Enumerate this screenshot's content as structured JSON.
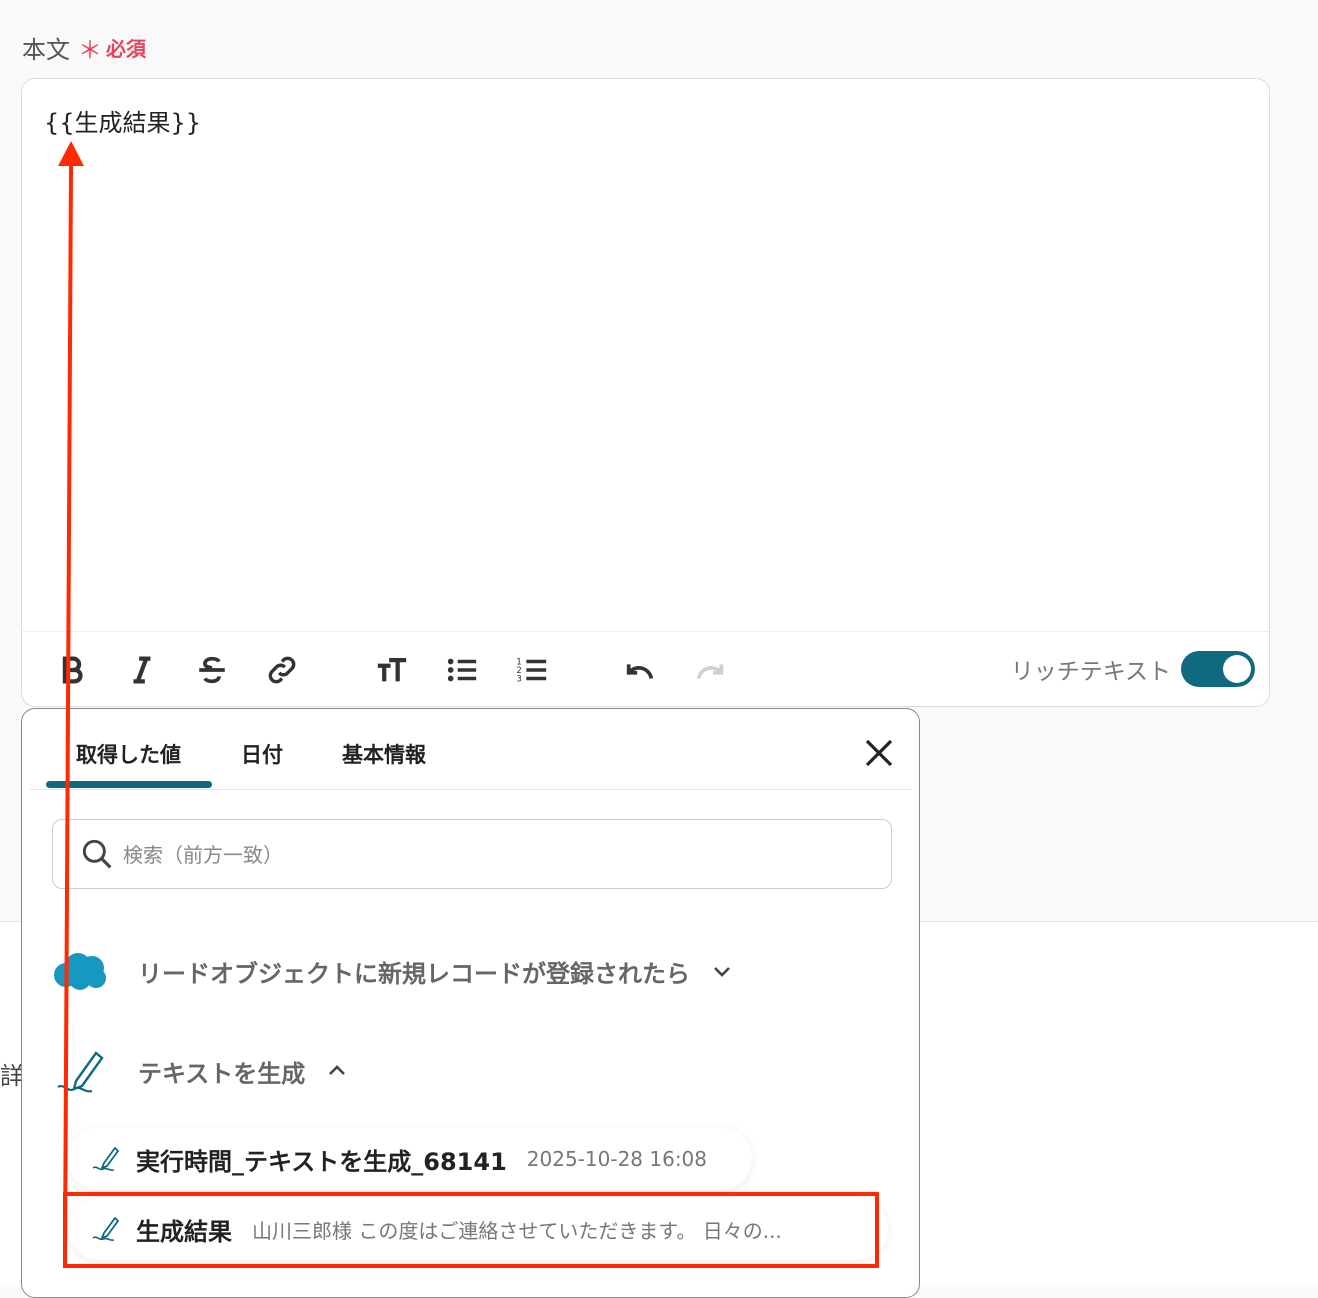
{
  "field": {
    "label": "本文",
    "required_mark": "＊",
    "required_text": "必須"
  },
  "editor": {
    "content": "{{生成結果}}",
    "rich_text_label": "リッチテキスト",
    "rich_text_enabled": true,
    "toolbar_icons": [
      "bold-icon",
      "italic-icon",
      "strikethrough-icon",
      "link-icon",
      "text-size-icon",
      "bullet-list-icon",
      "numbered-list-icon",
      "undo-icon",
      "redo-icon"
    ]
  },
  "panel": {
    "tabs": [
      {
        "label": "取得した値",
        "active": true
      },
      {
        "label": "日付"
      },
      {
        "label": "基本情報"
      }
    ],
    "search_placeholder": "検索（前方一致）",
    "groups": [
      {
        "title": "リードオブジェクトに新規レコードが登録されたら",
        "icon": "salesforce-cloud-icon",
        "expanded": false
      },
      {
        "title": "テキストを生成",
        "icon": "pen-icon",
        "expanded": true
      }
    ],
    "items": [
      {
        "name": "実行時間_テキストを生成_68141",
        "value": "2025-10-28 16:08"
      },
      {
        "name": "生成結果",
        "value": "山川三郎様 この度はご連絡させていただきます。 日々の..."
      }
    ]
  },
  "background": {
    "partial_label": "詳"
  },
  "colors": {
    "accent": "#0f6a80",
    "required": "#e8435a",
    "annotation": "#ff2a00",
    "salesforce": "#1798c1"
  }
}
